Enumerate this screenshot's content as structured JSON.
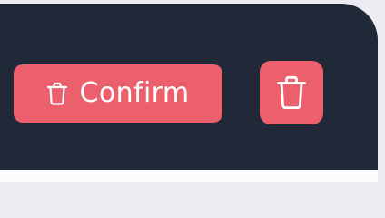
{
  "actions": {
    "confirm_label": "Confirm",
    "confirm_icon": "trash-icon",
    "icon_button_icon": "trash-icon"
  },
  "colors": {
    "panel": "#212838",
    "button": "#ec5f6d",
    "page": "#ebebf1",
    "text": "#ffffff"
  }
}
